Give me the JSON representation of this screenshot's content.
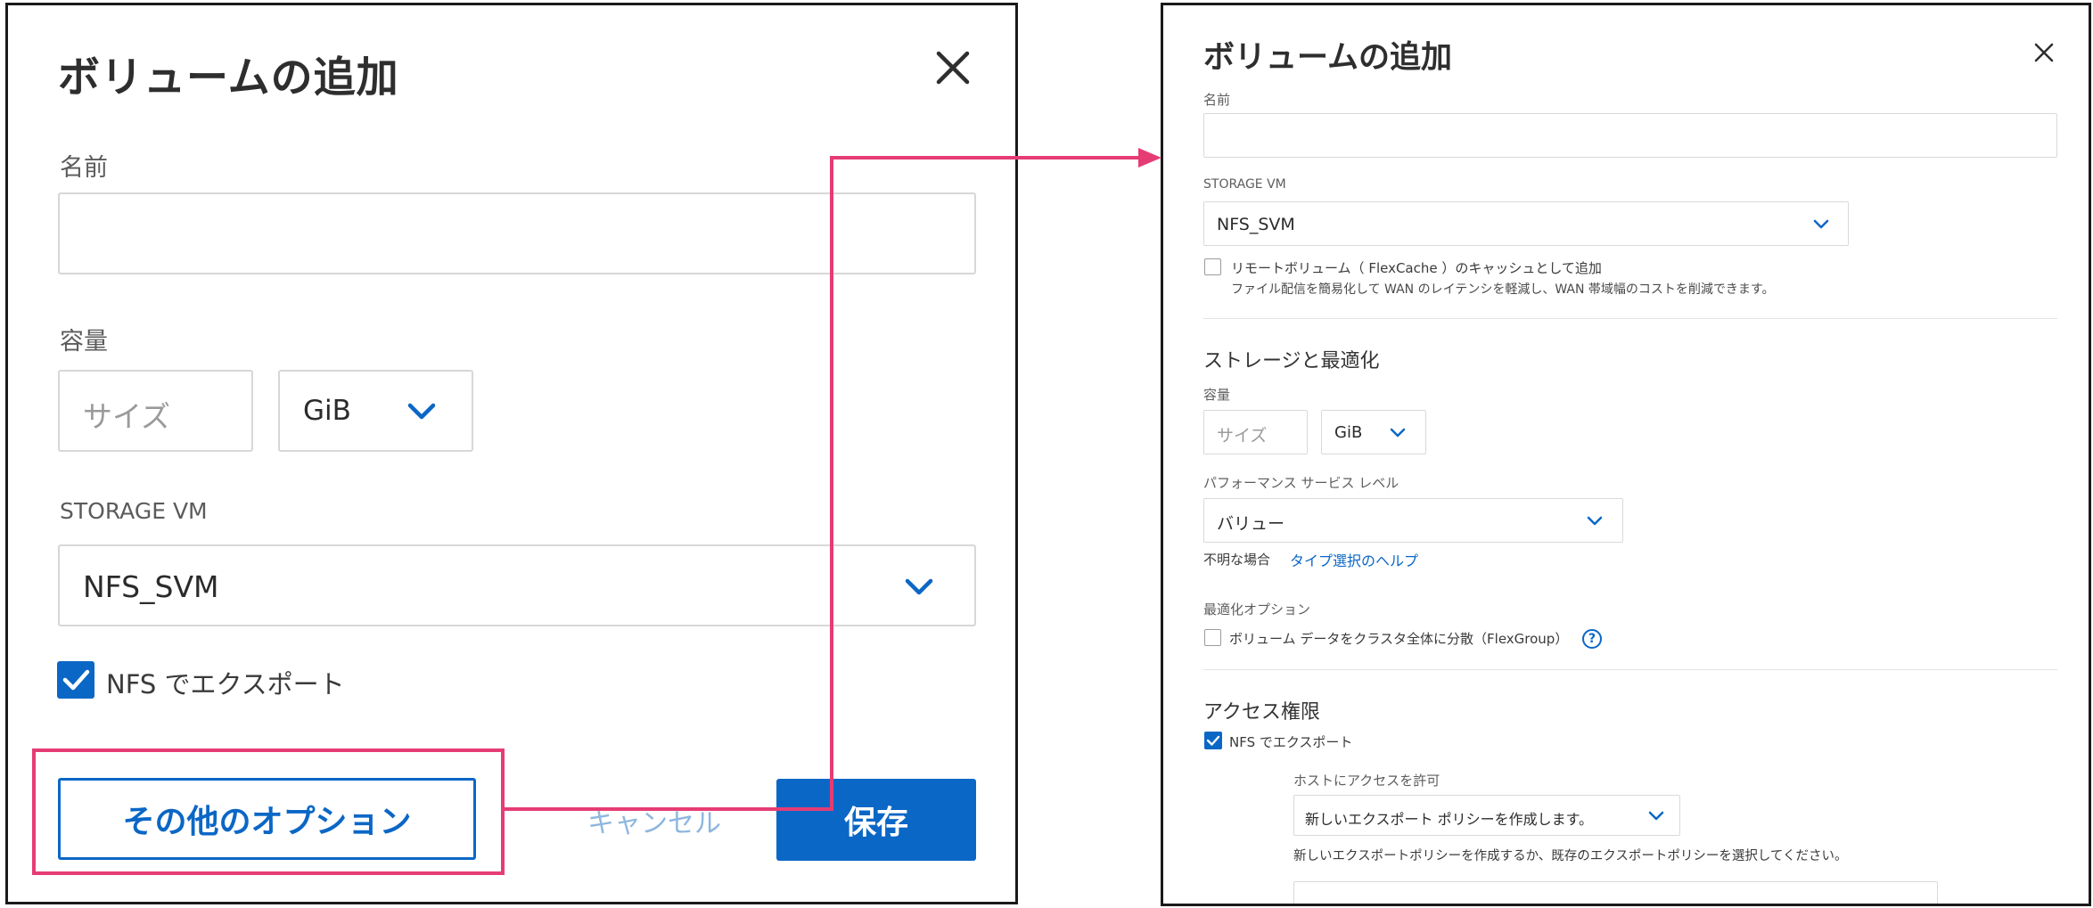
{
  "colors": {
    "accent": "#0b67c6",
    "highlight": "#e63c74"
  },
  "small_dialog": {
    "title": "ボリュームの追加",
    "close_icon": "close-icon",
    "name_label": "名前",
    "name_value": "",
    "capacity_label": "容量",
    "size_placeholder": "サイズ",
    "unit_value": "GiB",
    "storage_vm_label": "STORAGE VM",
    "storage_vm_value": "NFS_SVM",
    "nfs_export_label": "NFS でエクスポート",
    "nfs_export_checked": true,
    "more_options_label": "その他のオプション",
    "cancel_label": "キャンセル",
    "save_label": "保存"
  },
  "expanded_dialog": {
    "title": "ボリュームの追加",
    "close_icon": "close-icon",
    "name_label": "名前",
    "name_value": "",
    "storage_vm_label": "STORAGE VM",
    "storage_vm_value": "NFS_SVM",
    "flexcache_label": "リモートボリューム（ FlexCache ）のキャッシュとして追加",
    "flexcache_checked": false,
    "flexcache_desc": "ファイル配信を簡易化して WAN のレイテンシを軽減し、WAN 帯域幅のコストを削減できます。",
    "storage_section_title": "ストレージと最適化",
    "capacity_label": "容量",
    "size_placeholder": "サイズ",
    "unit_value": "GiB",
    "performance_label": "パフォーマンス サービス レベル",
    "performance_value": "バリュー",
    "unsure_text": "不明な場合",
    "type_help_link": "タイプ選択のヘルプ",
    "optimization_label": "最適化オプション",
    "flexgroup_label": "ボリューム データをクラスタ全体に分散（FlexGroup）",
    "flexgroup_checked": false,
    "help_icon": "?",
    "access_section_title": "アクセス権限",
    "nfs_export_label": "NFS でエクスポート",
    "nfs_export_checked": true,
    "host_access_label": "ホストにアクセスを許可",
    "policy_value": "新しいエクスポート ポリシーを作成します。",
    "policy_desc": "新しいエクスポートポリシーを作成するか、既存のエクスポートポリシーを選択してください。"
  }
}
